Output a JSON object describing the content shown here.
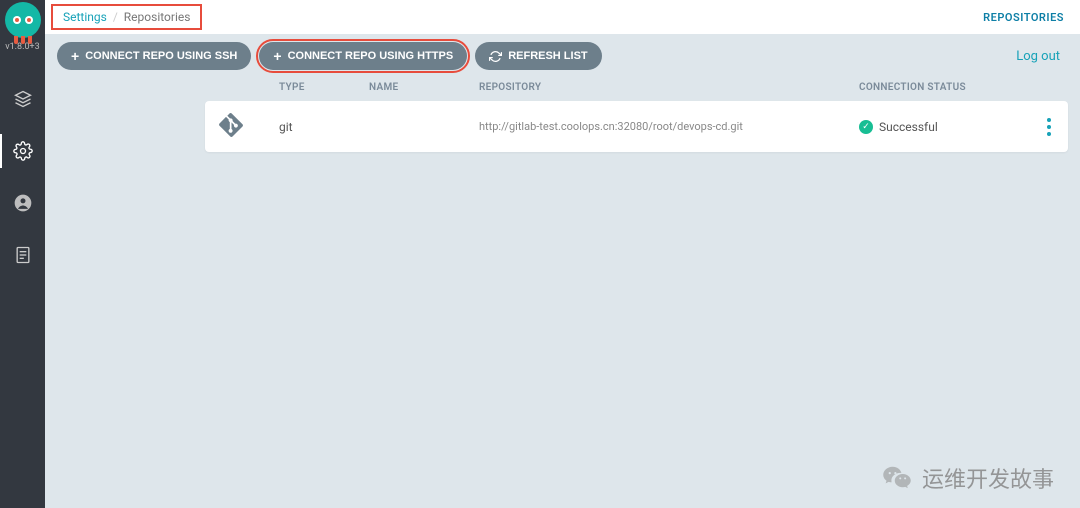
{
  "version": "v1.8.0+3",
  "breadcrumb": {
    "item1": "Settings",
    "item2": "Repositories"
  },
  "top_right_link": "REPOSITORIES",
  "actions": {
    "connect_ssh": "CONNECT REPO USING SSH",
    "connect_https": "CONNECT REPO USING HTTPS",
    "refresh": "REFRESH LIST",
    "logout": "Log out"
  },
  "columns": {
    "type": "TYPE",
    "name": "NAME",
    "repository": "REPOSITORY",
    "connection_status": "CONNECTION STATUS"
  },
  "rows": [
    {
      "type": "git",
      "name": "",
      "repository": "http://gitlab-test.coolops.cn:32080/root/devops-cd.git",
      "status": "Successful"
    }
  ],
  "watermark": "运维开发故事"
}
